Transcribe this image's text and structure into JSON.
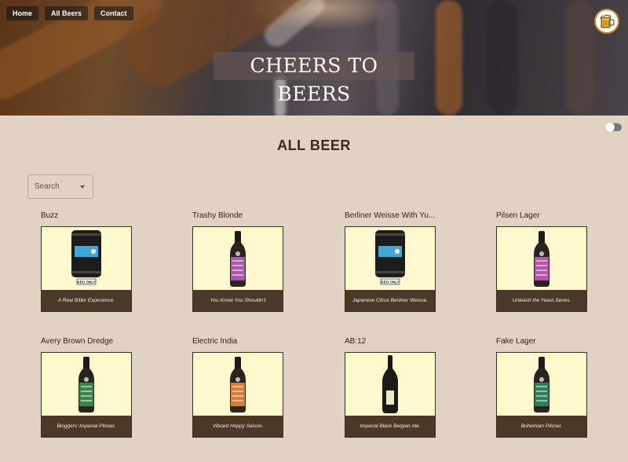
{
  "nav": {
    "items": [
      "Home",
      "All Beers",
      "Contact"
    ]
  },
  "hero": {
    "title": "CHEERS TO BEERS"
  },
  "page": {
    "title": "ALL BEER"
  },
  "search": {
    "placeholder": "Search"
  },
  "beers": [
    {
      "name": "Buzz",
      "tagline": "A Real Bitter Experience.",
      "image": "keg",
      "label_color": "#3fa7d6",
      "keg_text": "KEG ONLY"
    },
    {
      "name": "Trashy Blonde",
      "tagline": "You Know You Shouldn't",
      "image": "bottle",
      "label_color": "#b85fb8"
    },
    {
      "name": "Berliner Weisse With Yu...",
      "tagline": "Japanese Citrus Berliner Weisse.",
      "image": "keg",
      "label_color": "#3fa7d6",
      "keg_text": "KEG ONLY"
    },
    {
      "name": "Pilsen Lager",
      "tagline": "Unleash the Yeast Series.",
      "image": "bottle",
      "label_color": "#c45bb5"
    },
    {
      "name": "Avery Brown Dredge",
      "tagline": "Bloggers' Imperial Pilsner.",
      "image": "bottle",
      "label_color": "#3f8f4f"
    },
    {
      "name": "Electric India",
      "tagline": "Vibrant Hoppy Saison.",
      "image": "bottle",
      "label_color": "#e88a3a"
    },
    {
      "name": "AB:12",
      "tagline": "Imperial Black Belgian Ale.",
      "image": "tallbottle",
      "label_color": "#f0e6c8"
    },
    {
      "name": "Fake Lager",
      "tagline": "Bohemian Pilsner.",
      "image": "bottle",
      "label_color": "#2e8a5e"
    }
  ],
  "colors": {
    "background": "#e2d2c3",
    "card_footer": "#4b3828",
    "card_image_bg": "#fffacd",
    "title": "#3b2a1e"
  },
  "icons": {
    "logo": "beer-mug-logo-icon",
    "dropdown": "chevron-down-icon",
    "theme_toggle": "toggle-switch"
  }
}
